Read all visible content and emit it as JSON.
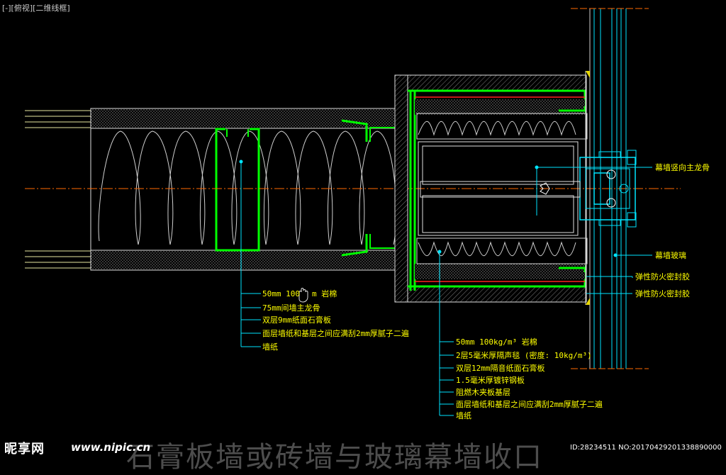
{
  "viewport_label": "[-][俯视][二维线框]",
  "labels_right": {
    "mullion": "幕墙竖向主龙骨",
    "glass": "幕墙玻璃",
    "sealant_1": "弹性防火密封胶",
    "sealant_2": "弹性防火密封胶"
  },
  "labels_left": [
    "50mm 100",
    "m 岩棉",
    "75mm间墙主龙骨",
    "双层9mm纸面石膏板",
    "面层墙纸和基层之间应满刮2mm厚腻子二遍",
    "墙纸"
  ],
  "labels_center": [
    "50mm 100kg/m³ 岩棉",
    "2层5毫米厚隔声毯 (密度: 10kg/m³)",
    "双层12mm隔音纸面石膏板",
    "1.5毫米厚镀锌钢板",
    "阻燃木夹板基层",
    "面层墙纸和基层之间应满刮2mm厚腻子二遍",
    "墙纸"
  ],
  "footer": {
    "title": "石膏板墙或砖墙与玻璃幕墙收口",
    "watermark_logo": "昵享网",
    "watermark_url": "www.nipic.cn",
    "id_text": "ID:28234511 NO:20170429201338890000"
  },
  "colors": {
    "background": "#000000",
    "wall_lines": "#d8d8d8",
    "steel": "#00ff00",
    "leaders": "#00e5ff",
    "text": "#ffff00",
    "frame": "#e0e0e0",
    "axis": "#ff6a00",
    "red": "#ff2020"
  },
  "icons": [
    "hand-cursor-icon"
  ]
}
